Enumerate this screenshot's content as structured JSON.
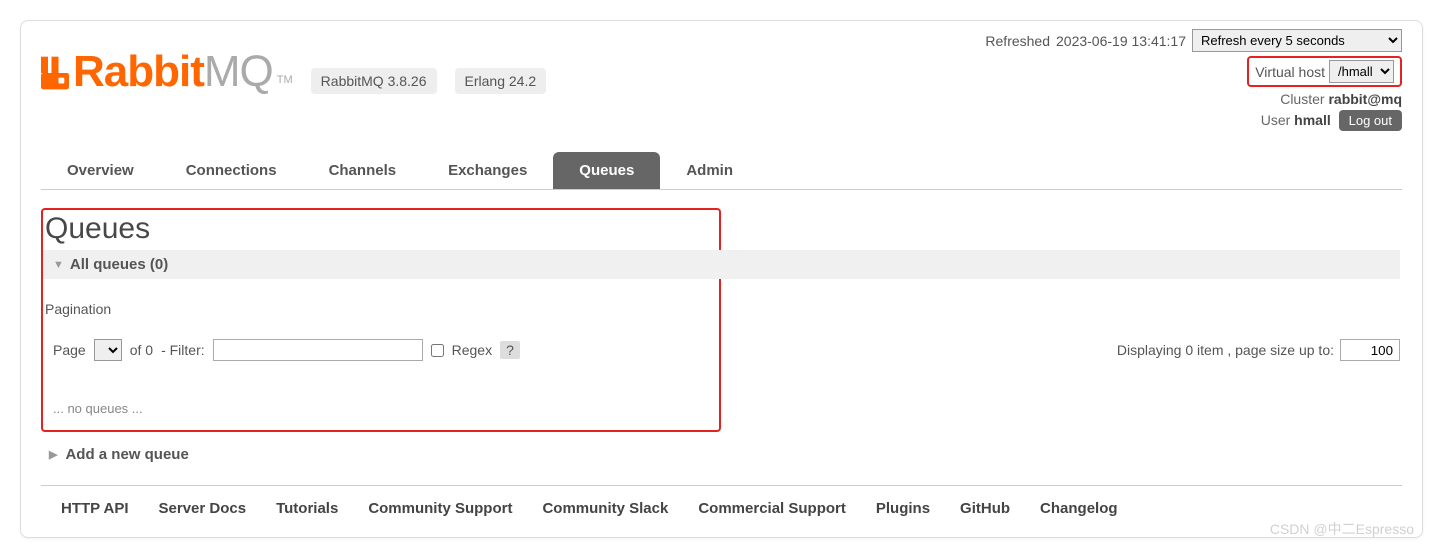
{
  "logo": {
    "brand": "Rabbit",
    "suffix": "MQ",
    "tm": "TM"
  },
  "versions": {
    "rabbitmq": "RabbitMQ 3.8.26",
    "erlang": "Erlang 24.2"
  },
  "status": {
    "refreshed_label": "Refreshed",
    "refreshed_time": "2023-06-19 13:41:17",
    "refresh_option": "Refresh every 5 seconds",
    "vhost_label": "Virtual host",
    "vhost_value": "/hmall",
    "cluster_label": "Cluster",
    "cluster_value": "rabbit@mq",
    "user_label": "User",
    "user_value": "hmall",
    "logout": "Log out"
  },
  "tabs": {
    "overview": "Overview",
    "connections": "Connections",
    "channels": "Channels",
    "exchanges": "Exchanges",
    "queues": "Queues",
    "admin": "Admin"
  },
  "page": {
    "title": "Queues",
    "section": "All queues (0)",
    "pagination_label": "Pagination",
    "page_label": "Page",
    "of_label": "of 0",
    "filter_label": "- Filter:",
    "regex_label": "Regex",
    "help": "?",
    "displaying": "Displaying 0 item , page size up to:",
    "pagesize": "100",
    "empty": "... no queues ...",
    "add": "Add a new queue"
  },
  "footer": {
    "http_api": "HTTP API",
    "server_docs": "Server Docs",
    "tutorials": "Tutorials",
    "community_support": "Community Support",
    "community_slack": "Community Slack",
    "commercial_support": "Commercial Support",
    "plugins": "Plugins",
    "github": "GitHub",
    "changelog": "Changelog"
  },
  "watermark": "CSDN @中二Espresso"
}
